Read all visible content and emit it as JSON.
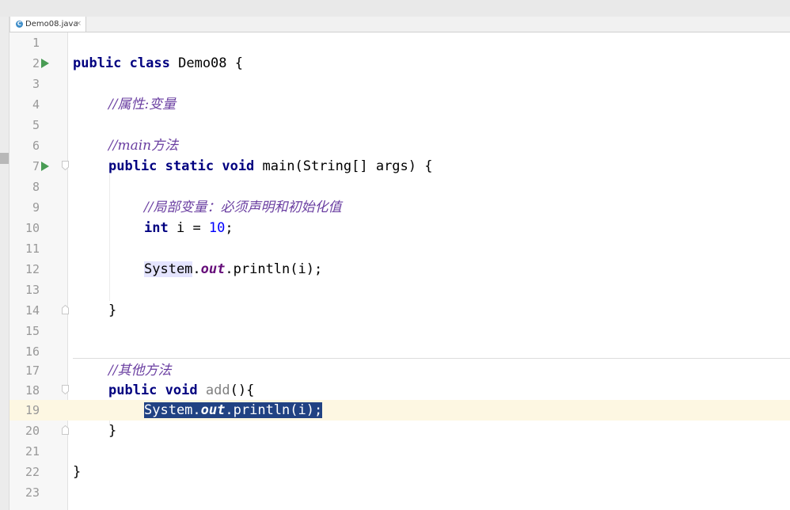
{
  "tab": {
    "file_name": "Demo08.java",
    "icon": "java-class-icon",
    "close": "×"
  },
  "editor": {
    "current_line": 19,
    "lines": [
      {
        "n": "1"
      },
      {
        "n": "2"
      },
      {
        "n": "3"
      },
      {
        "n": "4"
      },
      {
        "n": "5"
      },
      {
        "n": "6"
      },
      {
        "n": "7"
      },
      {
        "n": "8"
      },
      {
        "n": "9"
      },
      {
        "n": "10"
      },
      {
        "n": "11"
      },
      {
        "n": "12"
      },
      {
        "n": "13"
      },
      {
        "n": "14"
      },
      {
        "n": "15"
      },
      {
        "n": "16"
      },
      {
        "n": "17"
      },
      {
        "n": "18"
      },
      {
        "n": "19"
      },
      {
        "n": "20"
      },
      {
        "n": "21"
      },
      {
        "n": "22"
      },
      {
        "n": "23"
      }
    ],
    "code": {
      "l2": {
        "kw1": "public",
        "kw2": "class",
        "name": "Demo08 {"
      },
      "l4": {
        "comment": "//属性:变量"
      },
      "l6": {
        "comment": "//main方法"
      },
      "l7": {
        "kw1": "public",
        "kw2": "static",
        "kw3": "void",
        "rest": "main(String[] args) {"
      },
      "l9": {
        "comment": "//局部变量：必须声明和初始化值"
      },
      "l10": {
        "kw": "int",
        "mid": "i = ",
        "num": "10",
        "end": ";"
      },
      "l12": {
        "cls": "System",
        "dot": ".",
        "fld": "out",
        "rest": ".println(i);"
      },
      "l14": {
        "brace": "}"
      },
      "l17": {
        "comment": "//其他方法"
      },
      "l18": {
        "kw1": "public",
        "kw2": "void",
        "method": "add",
        "rest": "(){"
      },
      "l19": {
        "cls": "System",
        "dot": ".",
        "fld": "out",
        "rest": ".println(i);"
      },
      "l20": {
        "brace": "}"
      },
      "l22": {
        "brace": "}"
      }
    }
  },
  "colors": {
    "keyword": "#000080",
    "comment": "#6a3ea1",
    "number": "#0000ff",
    "field": "#660e7a",
    "selection": "#214283",
    "current_line": "#fdf7e2",
    "run_icon": "#499c54"
  }
}
